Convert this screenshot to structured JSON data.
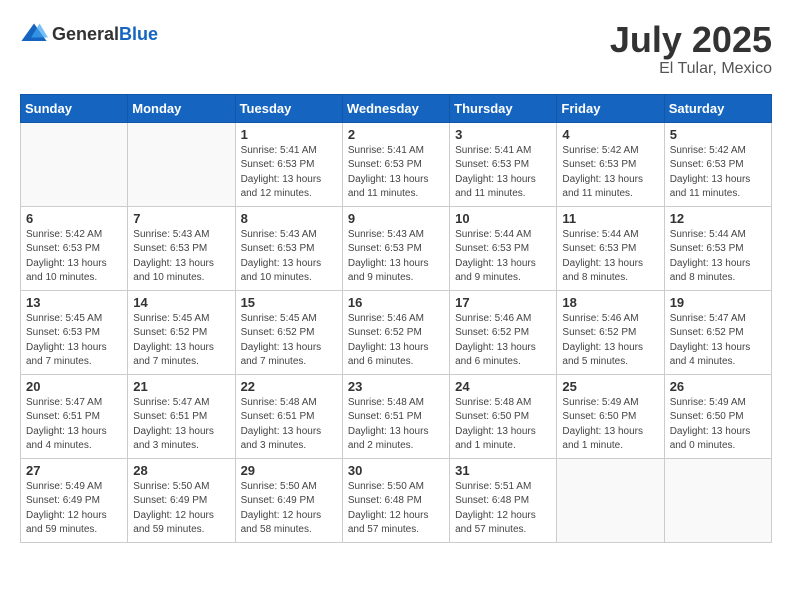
{
  "header": {
    "logo_general": "General",
    "logo_blue": "Blue",
    "month_year": "July 2025",
    "location": "El Tular, Mexico"
  },
  "weekdays": [
    "Sunday",
    "Monday",
    "Tuesday",
    "Wednesday",
    "Thursday",
    "Friday",
    "Saturday"
  ],
  "weeks": [
    [
      {
        "day": "",
        "info": ""
      },
      {
        "day": "",
        "info": ""
      },
      {
        "day": "1",
        "info": "Sunrise: 5:41 AM\nSunset: 6:53 PM\nDaylight: 13 hours\nand 12 minutes."
      },
      {
        "day": "2",
        "info": "Sunrise: 5:41 AM\nSunset: 6:53 PM\nDaylight: 13 hours\nand 11 minutes."
      },
      {
        "day": "3",
        "info": "Sunrise: 5:41 AM\nSunset: 6:53 PM\nDaylight: 13 hours\nand 11 minutes."
      },
      {
        "day": "4",
        "info": "Sunrise: 5:42 AM\nSunset: 6:53 PM\nDaylight: 13 hours\nand 11 minutes."
      },
      {
        "day": "5",
        "info": "Sunrise: 5:42 AM\nSunset: 6:53 PM\nDaylight: 13 hours\nand 11 minutes."
      }
    ],
    [
      {
        "day": "6",
        "info": "Sunrise: 5:42 AM\nSunset: 6:53 PM\nDaylight: 13 hours\nand 10 minutes."
      },
      {
        "day": "7",
        "info": "Sunrise: 5:43 AM\nSunset: 6:53 PM\nDaylight: 13 hours\nand 10 minutes."
      },
      {
        "day": "8",
        "info": "Sunrise: 5:43 AM\nSunset: 6:53 PM\nDaylight: 13 hours\nand 10 minutes."
      },
      {
        "day": "9",
        "info": "Sunrise: 5:43 AM\nSunset: 6:53 PM\nDaylight: 13 hours\nand 9 minutes."
      },
      {
        "day": "10",
        "info": "Sunrise: 5:44 AM\nSunset: 6:53 PM\nDaylight: 13 hours\nand 9 minutes."
      },
      {
        "day": "11",
        "info": "Sunrise: 5:44 AM\nSunset: 6:53 PM\nDaylight: 13 hours\nand 8 minutes."
      },
      {
        "day": "12",
        "info": "Sunrise: 5:44 AM\nSunset: 6:53 PM\nDaylight: 13 hours\nand 8 minutes."
      }
    ],
    [
      {
        "day": "13",
        "info": "Sunrise: 5:45 AM\nSunset: 6:53 PM\nDaylight: 13 hours\nand 7 minutes."
      },
      {
        "day": "14",
        "info": "Sunrise: 5:45 AM\nSunset: 6:52 PM\nDaylight: 13 hours\nand 7 minutes."
      },
      {
        "day": "15",
        "info": "Sunrise: 5:45 AM\nSunset: 6:52 PM\nDaylight: 13 hours\nand 7 minutes."
      },
      {
        "day": "16",
        "info": "Sunrise: 5:46 AM\nSunset: 6:52 PM\nDaylight: 13 hours\nand 6 minutes."
      },
      {
        "day": "17",
        "info": "Sunrise: 5:46 AM\nSunset: 6:52 PM\nDaylight: 13 hours\nand 6 minutes."
      },
      {
        "day": "18",
        "info": "Sunrise: 5:46 AM\nSunset: 6:52 PM\nDaylight: 13 hours\nand 5 minutes."
      },
      {
        "day": "19",
        "info": "Sunrise: 5:47 AM\nSunset: 6:52 PM\nDaylight: 13 hours\nand 4 minutes."
      }
    ],
    [
      {
        "day": "20",
        "info": "Sunrise: 5:47 AM\nSunset: 6:51 PM\nDaylight: 13 hours\nand 4 minutes."
      },
      {
        "day": "21",
        "info": "Sunrise: 5:47 AM\nSunset: 6:51 PM\nDaylight: 13 hours\nand 3 minutes."
      },
      {
        "day": "22",
        "info": "Sunrise: 5:48 AM\nSunset: 6:51 PM\nDaylight: 13 hours\nand 3 minutes."
      },
      {
        "day": "23",
        "info": "Sunrise: 5:48 AM\nSunset: 6:51 PM\nDaylight: 13 hours\nand 2 minutes."
      },
      {
        "day": "24",
        "info": "Sunrise: 5:48 AM\nSunset: 6:50 PM\nDaylight: 13 hours\nand 1 minute."
      },
      {
        "day": "25",
        "info": "Sunrise: 5:49 AM\nSunset: 6:50 PM\nDaylight: 13 hours\nand 1 minute."
      },
      {
        "day": "26",
        "info": "Sunrise: 5:49 AM\nSunset: 6:50 PM\nDaylight: 13 hours\nand 0 minutes."
      }
    ],
    [
      {
        "day": "27",
        "info": "Sunrise: 5:49 AM\nSunset: 6:49 PM\nDaylight: 12 hours\nand 59 minutes."
      },
      {
        "day": "28",
        "info": "Sunrise: 5:50 AM\nSunset: 6:49 PM\nDaylight: 12 hours\nand 59 minutes."
      },
      {
        "day": "29",
        "info": "Sunrise: 5:50 AM\nSunset: 6:49 PM\nDaylight: 12 hours\nand 58 minutes."
      },
      {
        "day": "30",
        "info": "Sunrise: 5:50 AM\nSunset: 6:48 PM\nDaylight: 12 hours\nand 57 minutes."
      },
      {
        "day": "31",
        "info": "Sunrise: 5:51 AM\nSunset: 6:48 PM\nDaylight: 12 hours\nand 57 minutes."
      },
      {
        "day": "",
        "info": ""
      },
      {
        "day": "",
        "info": ""
      }
    ]
  ]
}
